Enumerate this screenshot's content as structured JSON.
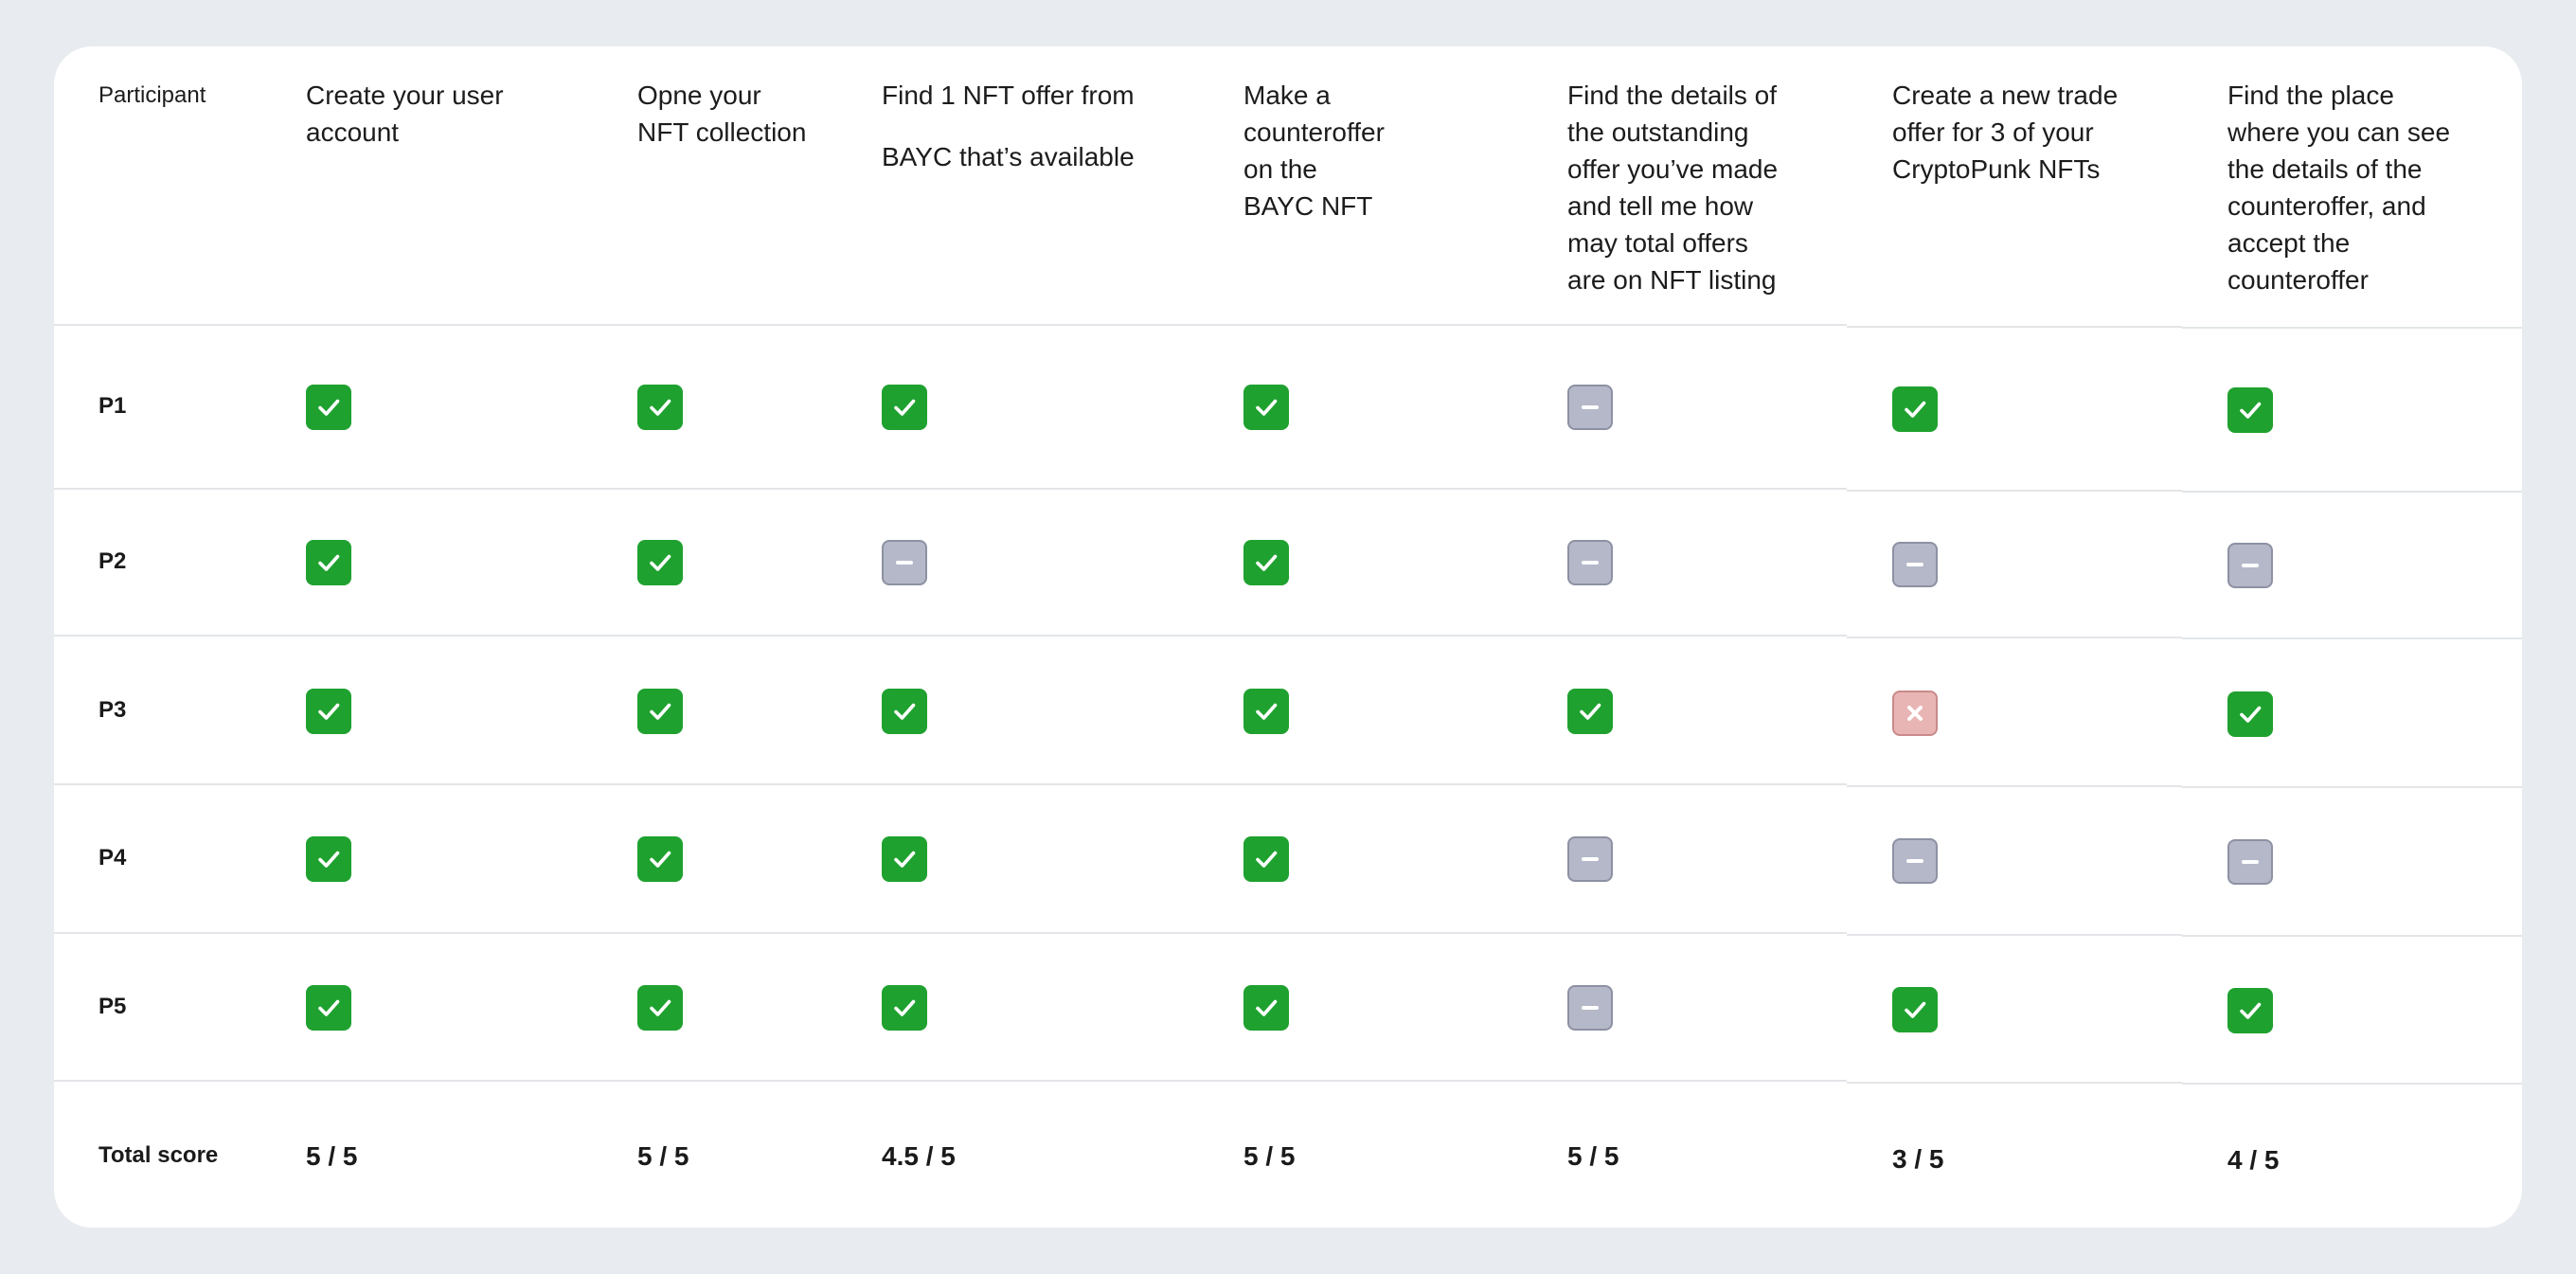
{
  "table": {
    "header": {
      "participant": "Participant",
      "tasks": [
        "Create your user\naccount",
        "Opne your\nNFT collection",
        "Find 1 NFT offer from",
        "Make a counteroffer on the BAYC NFT",
        "Find the details of\nthe outstanding\noffer you’ve made\nand tell me how\nmay total offers\nare on NFT listing",
        "Create a new trade\noffer for 3 of your\nCryptoPunk NFTs",
        "Find the place\nwhere you can see\nthe details of the\ncounteroffer, and\naccept the\ncounteroffer"
      ],
      "task3_line2": "BAYC that’s available"
    },
    "rows": [
      {
        "label": "P1",
        "statuses": [
          "pass",
          "pass",
          "pass",
          "pass",
          "partial",
          "pass",
          "pass"
        ]
      },
      {
        "label": "P2",
        "statuses": [
          "pass",
          "pass",
          "partial",
          "pass",
          "partial",
          "partial",
          "partial"
        ]
      },
      {
        "label": "P3",
        "statuses": [
          "pass",
          "pass",
          "pass",
          "pass",
          "pass",
          "fail",
          "pass"
        ]
      },
      {
        "label": "P4",
        "statuses": [
          "pass",
          "pass",
          "pass",
          "pass",
          "partial",
          "partial",
          "partial"
        ]
      },
      {
        "label": "P5",
        "statuses": [
          "pass",
          "pass",
          "pass",
          "pass",
          "partial",
          "pass",
          "pass"
        ]
      }
    ],
    "total": {
      "label": "Total score",
      "scores": [
        "5 / 5",
        "5 / 5",
        "4.5 / 5",
        "5 / 5",
        "5 / 5",
        "3 / 5",
        "4 / 5"
      ]
    }
  },
  "status_icons": {
    "pass": "check-icon",
    "partial": "minus-icon",
    "fail": "x-icon"
  },
  "colors": {
    "pass": "#1fa12f",
    "partial": "#b4b8c8",
    "fail": "#e9b4b4",
    "background": "#e8ebf0"
  }
}
